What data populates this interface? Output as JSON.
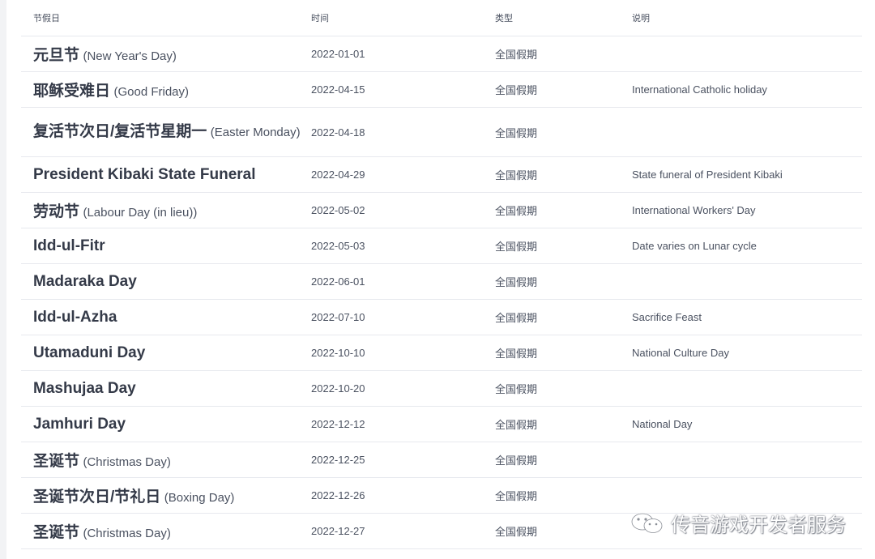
{
  "headers": {
    "name": "节假日",
    "date": "时间",
    "type": "类型",
    "desc": "说明"
  },
  "rows": [
    {
      "name": "元旦节",
      "sub": "(New Year's Day)",
      "date": "2022-01-01",
      "type": "全国假期",
      "desc": ""
    },
    {
      "name": "耶稣受难日",
      "sub": "(Good Friday)",
      "date": "2022-04-15",
      "type": "全国假期",
      "desc": "International Catholic holiday"
    },
    {
      "name": "复活节次日/复活节星期一",
      "sub": "(Easter Monday)",
      "date": "2022-04-18",
      "type": "全国假期",
      "desc": ""
    },
    {
      "name": "President Kibaki State Funeral",
      "sub": "",
      "date": "2022-04-29",
      "type": "全国假期",
      "desc": "State funeral of President Kibaki"
    },
    {
      "name": "劳动节",
      "sub": "(Labour Day (in lieu))",
      "date": "2022-05-02",
      "type": "全国假期",
      "desc": "International Workers' Day"
    },
    {
      "name": "Idd-ul-Fitr",
      "sub": "",
      "date": "2022-05-03",
      "type": "全国假期",
      "desc": "Date varies on Lunar cycle"
    },
    {
      "name": "Madaraka Day",
      "sub": "",
      "date": "2022-06-01",
      "type": "全国假期",
      "desc": ""
    },
    {
      "name": "Idd-ul-Azha",
      "sub": "",
      "date": "2022-07-10",
      "type": "全国假期",
      "desc": "Sacrifice Feast"
    },
    {
      "name": "Utamaduni Day",
      "sub": "",
      "date": "2022-10-10",
      "type": "全国假期",
      "desc": "National Culture Day"
    },
    {
      "name": "Mashujaa Day",
      "sub": "",
      "date": "2022-10-20",
      "type": "全国假期",
      "desc": ""
    },
    {
      "name": "Jamhuri Day",
      "sub": "",
      "date": "2022-12-12",
      "type": "全国假期",
      "desc": "National Day"
    },
    {
      "name": "圣诞节",
      "sub": "(Christmas Day)",
      "date": "2022-12-25",
      "type": "全国假期",
      "desc": ""
    },
    {
      "name": "圣诞节次日/节礼日",
      "sub": "(Boxing Day)",
      "date": "2022-12-26",
      "type": "全国假期",
      "desc": ""
    },
    {
      "name": "圣诞节",
      "sub": "(Christmas Day)",
      "date": "2022-12-27",
      "type": "全国假期",
      "desc": ""
    }
  ],
  "watermark": {
    "text": "传音游戏开发者服务",
    "icon": "wechat-icon"
  }
}
